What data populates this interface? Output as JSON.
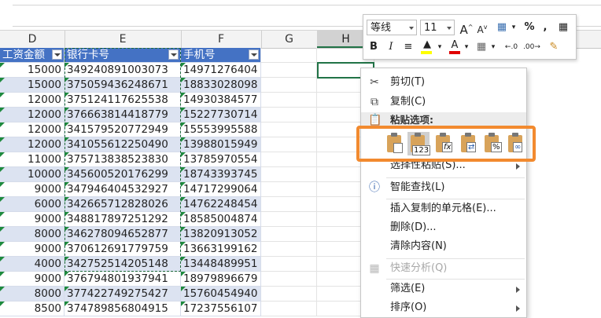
{
  "columns": [
    "D",
    "E",
    "F",
    "G",
    "H"
  ],
  "table_headers": {
    "d": "工资金额",
    "e": "银行卡号",
    "f": "手机号"
  },
  "rows": [
    {
      "d": "15000",
      "e": "349240891003073",
      "f": "14971276404"
    },
    {
      "d": "15000",
      "e": "375059436248671",
      "f": "18833028098"
    },
    {
      "d": "12000",
      "e": "375124117625538",
      "f": "14930384577"
    },
    {
      "d": "12000",
      "e": "376663814418779",
      "f": "15227730714"
    },
    {
      "d": "12000",
      "e": "341579520772949",
      "f": "15553995588"
    },
    {
      "d": "12000",
      "e": "341055612250490",
      "f": "13988015949"
    },
    {
      "d": "11000",
      "e": "375713838523830",
      "f": "13785970554"
    },
    {
      "d": "10000",
      "e": "345600520176299",
      "f": "18743393745"
    },
    {
      "d": "9000",
      "e": "347946404532927",
      "f": "14717299064"
    },
    {
      "d": "6000",
      "e": "342665712828026",
      "f": "14762248454"
    },
    {
      "d": "9000",
      "e": "348817897251292",
      "f": "18585004874"
    },
    {
      "d": "8000",
      "e": "346278094652877",
      "f": "13820913052"
    },
    {
      "d": "9000",
      "e": "370612691779759",
      "f": "13663199162"
    },
    {
      "d": "4000",
      "e": "342752514205148",
      "f": "13448489951"
    },
    {
      "d": "9000",
      "e": "376794801937941",
      "f": "18979896679"
    },
    {
      "d": "8000",
      "e": "377422749275427",
      "f": "15760454940"
    },
    {
      "d": "8500",
      "e": "374789856804915",
      "f": "17237556107"
    }
  ],
  "mini_toolbar": {
    "font_name": "等线",
    "font_size": "11",
    "bold": "B",
    "italic": "I",
    "percent": "%",
    "comma": ","
  },
  "context_menu": {
    "cut": "剪切(T)",
    "copy": "复制(C)",
    "paste_options": "粘贴选项:",
    "paste_special": "选择性粘贴(S)...",
    "smart_lookup": "智能查找(L)",
    "insert_copied": "插入复制的单元格(E)...",
    "delete": "删除(D)...",
    "clear": "清除内容(N)",
    "quick_analysis": "快速分析(Q)",
    "filter": "筛选(E)",
    "sort": "排序(O)"
  },
  "paste_buttons": [
    {
      "name": "paste",
      "badge": ""
    },
    {
      "name": "paste-values",
      "badge": "123"
    },
    {
      "name": "paste-formulas",
      "badge": "fx"
    },
    {
      "name": "paste-transpose",
      "badge": "⇄"
    },
    {
      "name": "paste-formatting",
      "badge": "%"
    },
    {
      "name": "paste-link",
      "badge": "∞"
    }
  ],
  "colors": {
    "accent": "#217346",
    "table_header": "#4472c4",
    "band": "#dce3f1",
    "highlight": "#f28a2f"
  }
}
